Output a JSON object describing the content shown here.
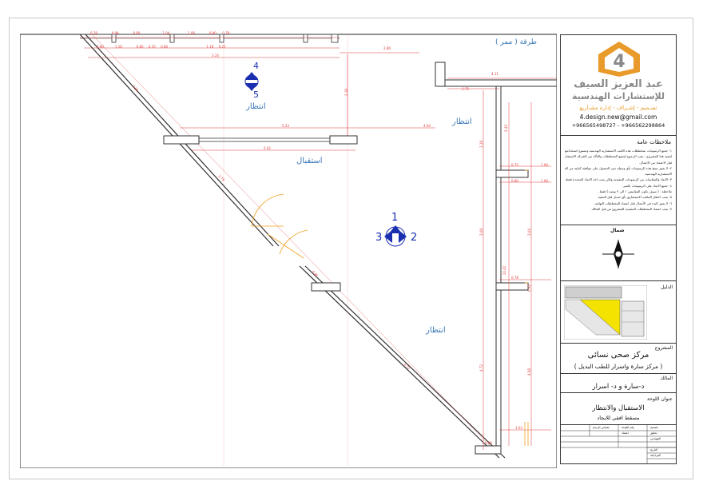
{
  "plan": {
    "room_labels": {
      "corridor": "طرقة ( ممر )",
      "waiting_top": "انتظار",
      "waiting_mid": "انتظار",
      "reception": "استقبال",
      "waiting_bottom": "انتظار"
    },
    "section_markers": {
      "top_a": "4",
      "top_b": "5",
      "mid_top": "1",
      "mid_left": "3",
      "mid_right": "2"
    },
    "dimensions": {
      "top_row": [
        "0.78",
        "0.94",
        "0.80",
        "1.04",
        "1.06",
        "0.80",
        "0.78"
      ],
      "second_row": [
        "0.80",
        "1.18",
        "0.80",
        "0.35",
        "0.80",
        "1.18",
        "0.25"
      ],
      "width_a": "3.24",
      "width_b": "2.86",
      "width_c": "4.11",
      "width_d": "1.75",
      "mid_a": "5.23",
      "mid_b": "4.04",
      "mid_c": "5.02",
      "diag_a": "3.58",
      "diag_b": "2.79",
      "diag_c": "0.95",
      "diag_d": "4.72",
      "vert_a": "2.18",
      "vert_b": "2.43",
      "vert_c": "3.18",
      "vert_d": "3.08",
      "vert_e": "3.04",
      "vert_f": "10.42",
      "vert_g": "0.52",
      "vert_h": "4.72",
      "vert_i": "4.58",
      "side_a": "0.75",
      "side_b": "1.00",
      "side_c": "0.80",
      "side_d": "1.00",
      "side_e": "0.78",
      "bottom_a": "1.03",
      "bottom_b": "0.29"
    }
  },
  "title_block": {
    "company_name": "عبد العزيز السيف",
    "company_subtitle": "للإستشارات الهندسية",
    "company_services": "تصـميم - إشـراف - إدارة مشـاريع",
    "email": "4.design.new@gmail.com",
    "phones": "+966565498727 - +966562298864",
    "notes_title": "ملاحظات عامة",
    "notes": [
      "١- جميع الرسومات بمخططات هذه الكتب الاستشارية الهندسية وممنوع استخدامها",
      "لتنفيذ هذا المشروع - يجب الرجوع لجميع المخططات والتأكد من الشركة الاستشارية",
      "قبل الاعتماد من الاعمال.",
      "٢- لا يجوز نسخ هذه الرسومات بأي وسيلة دون الحصول على موافقة كتابية من الشركة",
      "الاستشارية الهندسية.",
      "٣- الابعاد والمقاسات من الرسومات التنفيذية ولكن يجب اخذ الابعاد المحددة فقط.",
      "٤- جميع الابعاد على الرسومات بالمتر.",
      "ملاحظة : ( سوف تكون المقاييس ١ الى ٧ بوصة ) فقط .",
      "٥- يجب اخطار المكتب الاستشاري بأي تعديل قبل التنفيذ.",
      "٦- لا يجوز البدء في الأعمال قبل اعتماد المخططات النهائية.",
      "٧- يجب اعتماد المخططات التنفيذية للمشروع من قبل المالك."
    ],
    "compass_label": "شمال",
    "guide_label": "الدليل",
    "project_label": "المشروع",
    "project_name": "مركز صحى نسائى",
    "project_sub": "( مركز سارة واسرار للطب البديل )",
    "owner_label": "المالك",
    "owner_name": "د-سارة و د- اسرار",
    "sheet_title_label": "عنوان اللوحة",
    "sheet_title": "الاستقبال والانتظار",
    "sheet_subtitle": "مسقط افقى للايجاد",
    "table_labels": {
      "designer": "تصميم",
      "drawing_no": "رقم اللوحة",
      "scale": "مقياس الرسم",
      "checked": "تدقيق",
      "approved": "اعتماد",
      "engineer": "المهندس",
      "date": "التاريخ",
      "revision": "المراجعة"
    }
  },
  "colors": {
    "wall": "#333333",
    "dimension": "#e03b3b",
    "label": "#3a78b8",
    "marker": "#1a2fb0",
    "door": "#f0a020",
    "logo_orange": "#e89a2a",
    "logo_gray": "#8a8a8a",
    "guide_yellow": "#f4e300"
  }
}
